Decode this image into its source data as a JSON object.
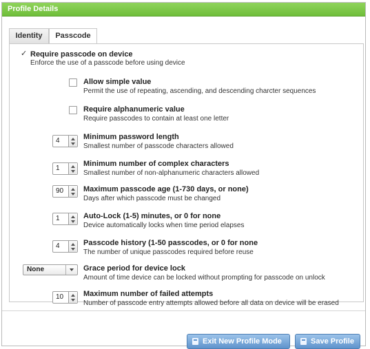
{
  "window": {
    "title": "Profile Details"
  },
  "tabs": [
    {
      "label": "Identity",
      "active": false
    },
    {
      "label": "Passcode",
      "active": true
    }
  ],
  "settings": {
    "require_passcode": {
      "checked": true,
      "label": "Require passcode on device",
      "description": "Enforce the use of a passcode before using device"
    },
    "allow_simple": {
      "checked": false,
      "label": "Allow simple value",
      "description": "Permit the use of repeating, ascending, and descending charcter sequences"
    },
    "require_alphanumeric": {
      "checked": false,
      "label": "Require alphanumeric value",
      "description": "Require passcodes to contain at least one letter"
    },
    "min_length": {
      "value": "4",
      "label": "Minimum password length",
      "description": "Smallest number of passcode characters allowed"
    },
    "min_complex": {
      "value": "1",
      "label": "Minimum number of complex characters",
      "description": "Smallest number of non-alphanumeric characters allowed"
    },
    "max_age": {
      "value": "90",
      "label": "Maximum passcode age (1-730 days, or none)",
      "description": "Days after which passcode must be changed"
    },
    "auto_lock": {
      "value": "1",
      "label": "Auto-Lock (1-5) minutes, or 0 for none",
      "description": "Device automatically locks when time period elapses"
    },
    "history": {
      "value": "4",
      "label": "Passcode history (1-50 passcodes, or 0 for none",
      "description": "The number of unique passcodes required before reuse"
    },
    "grace_period": {
      "value": "None",
      "label": "Grace period for device lock",
      "description": "Amount of time device can be locked without prompting for passcode on unlock"
    },
    "max_failed": {
      "value": "10",
      "label": "Maximum number of failed attempts",
      "description": "Number of passcode entry attempts allowed before all data on device will be erased"
    }
  },
  "footer": {
    "exit_label": "Exit New Profile Mode",
    "save_label": "Save Profile"
  },
  "colors": {
    "titlebar": "#7cc84a",
    "button": "#6f9fd3"
  },
  "icons": {
    "checked": "check-icon",
    "stepper": "stepper-arrows-icon",
    "dropdown": "chevron-down-icon",
    "button": "document-icon"
  }
}
